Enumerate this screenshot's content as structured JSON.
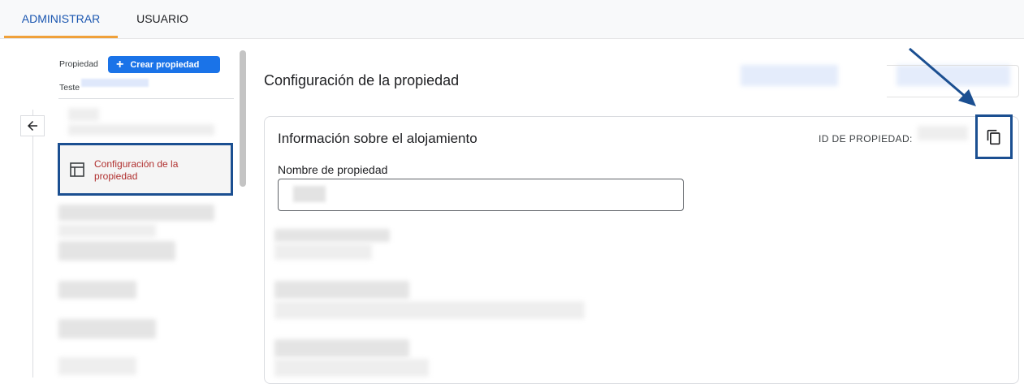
{
  "tabs": [
    {
      "label": "ADMINISTRAR",
      "active": true
    },
    {
      "label": "USUARIO",
      "active": false
    }
  ],
  "nav": {
    "property_label": "Propiedad",
    "create_button_label": "Crear propiedad",
    "property_name": "Teste",
    "selected_item_label": "Configuración de la propiedad"
  },
  "main": {
    "page_title": "Configuración de la propiedad",
    "card_title": "Información sobre el alojamiento",
    "property_id_label": "ID DE PROPIEDAD:",
    "property_name_field_label": "Nombre de propiedad"
  },
  "icons": {
    "back": "arrow-left-icon",
    "add": "plus-icon",
    "property_settings": "layout-icon",
    "copy": "copy-icon"
  },
  "colors": {
    "accent_blue": "#1a73e8",
    "tab_active_text": "#1a56b0",
    "tab_underline": "#f0a13a",
    "highlight_border": "#1b4f91",
    "selected_text": "#b0302f"
  }
}
